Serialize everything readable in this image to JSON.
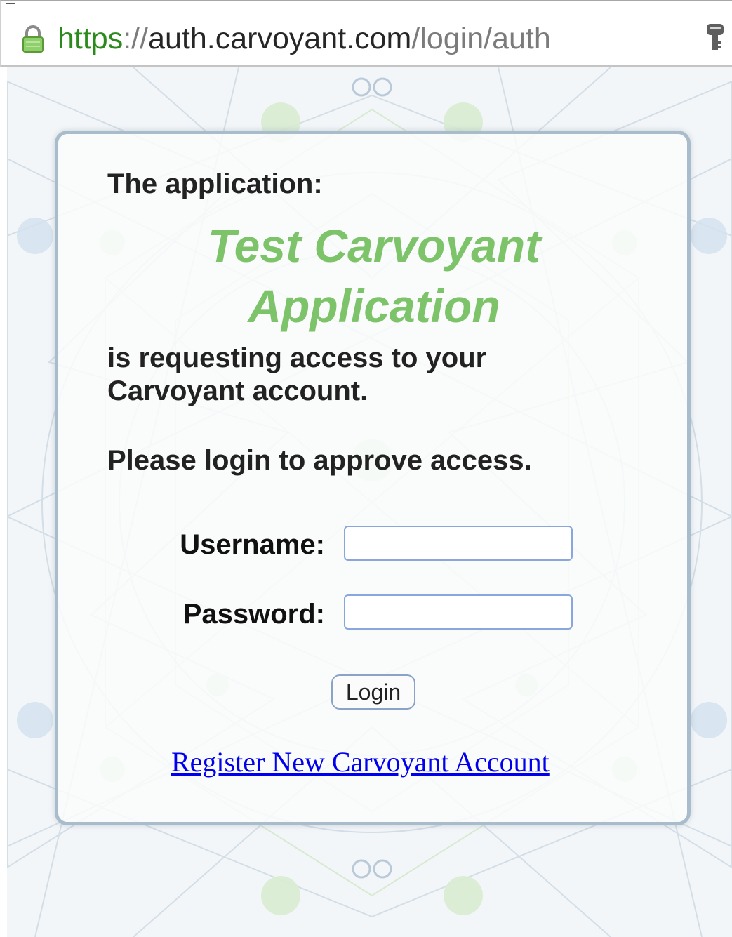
{
  "browser": {
    "url": {
      "scheme": "https",
      "separator": "://",
      "host": "auth.carvoyant.com",
      "path": "/login/auth"
    },
    "icons": {
      "lock": "lock-icon",
      "key": "key-icon"
    }
  },
  "page": {
    "intro": "The application:",
    "app_name": "Test Carvoyant Application",
    "requesting": "is requesting access to your Carvoyant account.",
    "please_login": "Please login to approve access.",
    "form": {
      "username_label": "Username:",
      "username_value": "",
      "password_label": "Password:",
      "password_value": "",
      "login_button": "Login"
    },
    "register_link": "Register New Carvoyant Account"
  },
  "colors": {
    "app_name": "#7dc36a",
    "secure_scheme": "#2b8a1c",
    "card_border": "#a9bccb",
    "input_border": "#89a7dc",
    "link": "#0000ee"
  }
}
